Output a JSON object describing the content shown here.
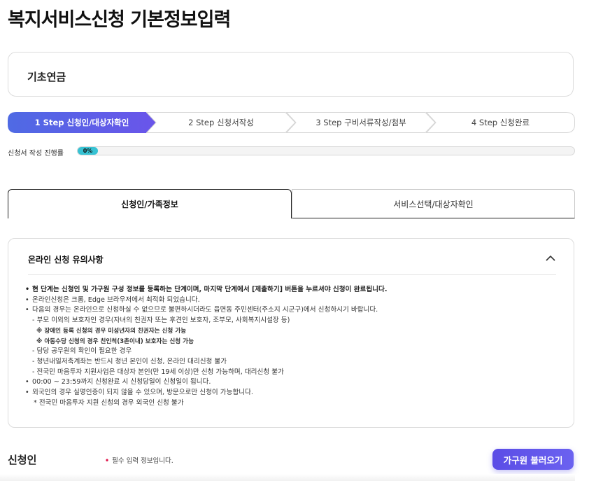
{
  "page": {
    "title": "복지서비스신청 기본정보입력"
  },
  "service": {
    "name": "기초연금"
  },
  "steps": [
    {
      "label": "1 Step 신청인/대상자확인",
      "active": true
    },
    {
      "label": "2 Step 신청서작성",
      "active": false
    },
    {
      "label": "3 Step 구비서류작성/첨부",
      "active": false
    },
    {
      "label": "4 Step 신청완료",
      "active": false
    }
  ],
  "progress": {
    "label": "신청서 작성 진행률",
    "value_text": "0%",
    "value": 0
  },
  "tabs": [
    {
      "label": "신청인/가족정보",
      "selected": true
    },
    {
      "label": "서비스선택/대상자확인",
      "selected": false
    }
  ],
  "notice": {
    "title": "온라인 신청 유의사항",
    "lines": [
      {
        "type": "bullet-strong",
        "text": "현 단계는 신청인 및 가구원 구성 정보를 등록하는 단계이며, 마지막 단계에서 [제출하기] 버튼을 누르셔야 신청이 완료됩니다."
      },
      {
        "type": "bullet",
        "text": "온라인신청은 크롬, Edge 브라우저에서 최적화 되었습니다."
      },
      {
        "type": "bullet",
        "text": "다음의 경우는 온라인으로 신청하실 수 없으므로 불편하시더라도 읍면동 주민센터(주소지 시군구)에서 신청하시기 바랍니다."
      },
      {
        "type": "sub",
        "text": "- 부모 이외의 보호자인 경우(자녀의 친권자 또는 후견인 보호자, 조부모, 사회복지시설장 등)"
      },
      {
        "type": "star",
        "text": "※ 장애인 등록 신청의 경우 미성년자의 친권자는 신청 가능"
      },
      {
        "type": "star",
        "text": "※ 아동수당 신청의 경우 친인척(3촌이내) 보호자는 신청 가능"
      },
      {
        "type": "sub",
        "text": "- 담당 공무원의 확인이 필요한 경우"
      },
      {
        "type": "sub",
        "text": "- 청년내일저축계좌는 반드시 청년 본인이 신청, 온라인 대리신청 불가"
      },
      {
        "type": "sub",
        "text": "- 전국민 마음투자 지원사업은 대상자 본인(만 19세 이상)만 신청 가능하며, 대리신청 불가"
      },
      {
        "type": "bullet",
        "text": "00:00 ~ 23:59까지 신청완료 시 신청당일이 신청일이 됩니다."
      },
      {
        "type": "bullet",
        "text": "외국인의 경우 실명인증이 되지 않을 수 있으며, 방문으로만 신청이 가능합니다."
      },
      {
        "type": "note",
        "text": "* 전국민 마음투자 지원 신청의 경우 외국인 신청 불가"
      }
    ]
  },
  "applicant": {
    "title": "신청인",
    "required_dot": "•",
    "required_note": "필수 입력 정보입니다.",
    "load_button": "가구원 불러오기"
  },
  "colors": {
    "accent": "#5b4de6",
    "progress": "#37c2d3",
    "required": "#e0174c"
  }
}
